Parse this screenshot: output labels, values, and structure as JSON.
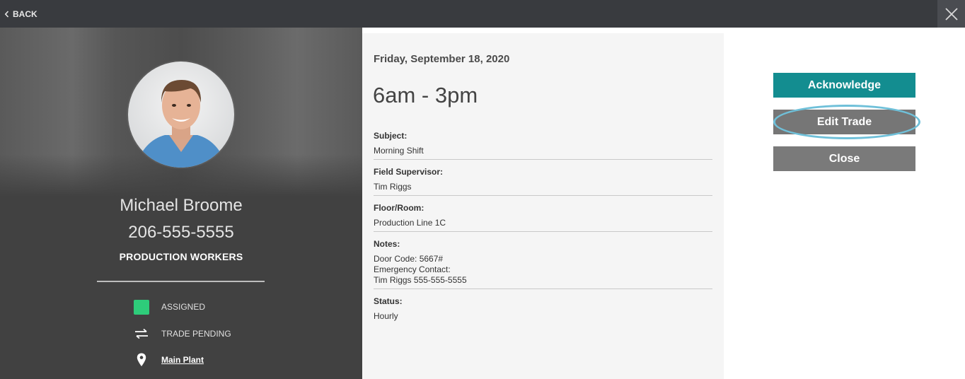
{
  "topbar": {
    "back_label": "BACK"
  },
  "profile": {
    "name": "Michael Broome",
    "phone": "206-555-5555",
    "role": "PRODUCTION WORKERS",
    "legend": {
      "assigned": "ASSIGNED",
      "trade_pending": "TRADE PENDING",
      "location": "Main Plant"
    },
    "colors": {
      "assigned": "#2ecc7a"
    }
  },
  "shift": {
    "date": "Friday, September 18, 2020",
    "time": "6am - 3pm",
    "fields": [
      {
        "label": "Subject:",
        "value": "Morning Shift"
      },
      {
        "label": "Field Supervisor:",
        "value": "Tim Riggs"
      },
      {
        "label": "Floor/Room:",
        "value": "Production Line 1C"
      },
      {
        "label": "Notes:",
        "value": "Door Code: 5667#\nEmergency Contact:\nTim Riggs 555-555-5555"
      },
      {
        "label": "Status:",
        "value": "Hourly"
      }
    ]
  },
  "actions": {
    "acknowledge": "Acknowledge",
    "edit_trade": "Edit Trade",
    "close": "Close",
    "colors": {
      "acknowledge": "#138d90",
      "secondary": "#767676",
      "highlight": "#6fc0d9"
    }
  }
}
